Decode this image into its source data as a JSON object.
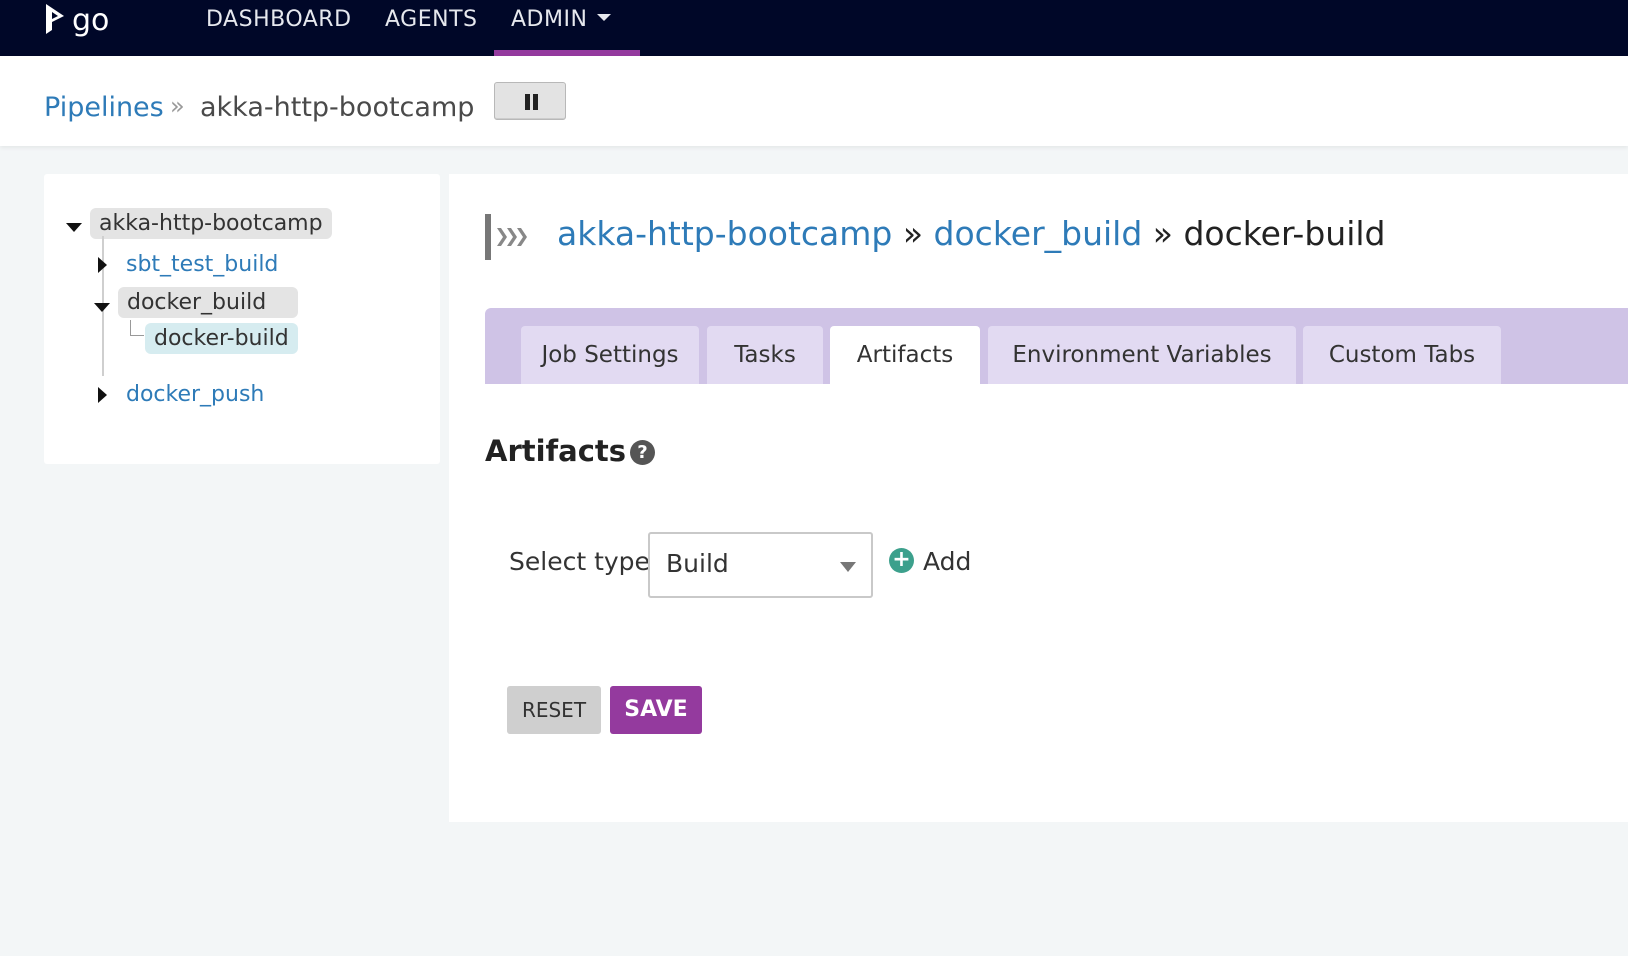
{
  "nav": {
    "logo_text": "go",
    "items": [
      {
        "label": "DASHBOARD"
      },
      {
        "label": "AGENTS"
      },
      {
        "label": "ADMIN"
      }
    ]
  },
  "header": {
    "breadcrumb_link": "Pipelines",
    "breadcrumb_sep": "»",
    "breadcrumb_current": "akka-http-bootcamp"
  },
  "tree": {
    "pipeline": "akka-http-bootcamp",
    "stages": [
      {
        "name": "sbt_test_build",
        "expanded": false
      },
      {
        "name": "docker_build",
        "expanded": true,
        "jobs": [
          "docker-build"
        ]
      },
      {
        "name": "docker_push",
        "expanded": false
      }
    ]
  },
  "job": {
    "pipeline": "akka-http-bootcamp",
    "sep1": " » ",
    "stage": "docker_build",
    "sep2": " » ",
    "name": "docker-build"
  },
  "tabs": [
    {
      "label": "Job Settings"
    },
    {
      "label": "Tasks"
    },
    {
      "label": "Artifacts",
      "active": true
    },
    {
      "label": "Environment Variables"
    },
    {
      "label": "Custom Tabs"
    }
  ],
  "artifacts": {
    "title": "Artifacts",
    "help_glyph": "?",
    "select_label": "Select type:",
    "select_value": "Build",
    "add_glyph": "+",
    "add_label": "Add"
  },
  "buttons": {
    "reset": "RESET",
    "save": "SAVE"
  },
  "colors": {
    "nav_bg": "#000728",
    "accent": "#943a9e",
    "link": "#2e7bb8",
    "tabs_bg": "#cfc3e6"
  }
}
